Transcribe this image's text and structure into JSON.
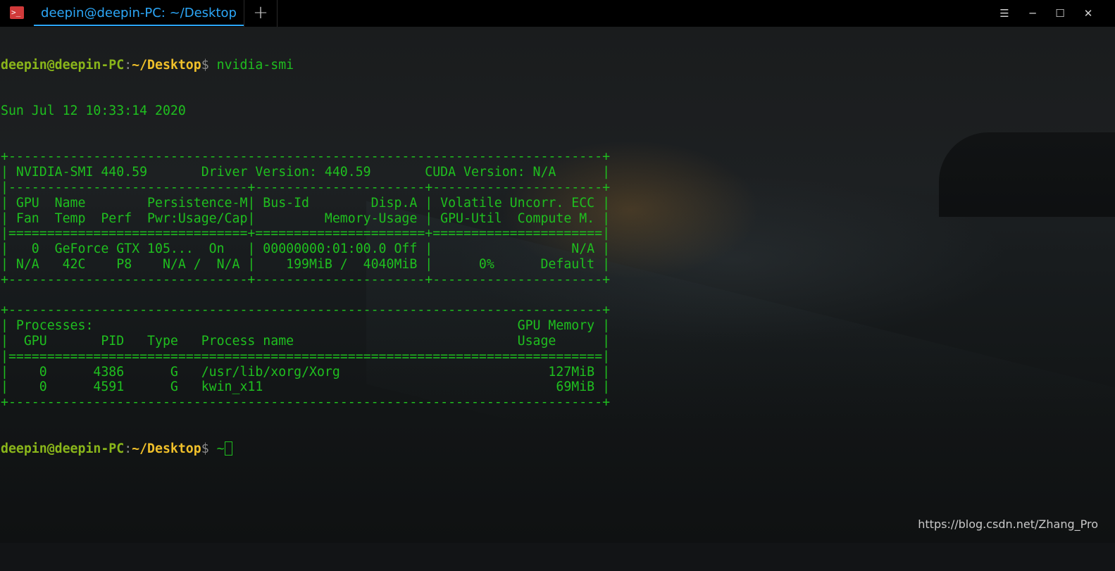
{
  "window": {
    "tab_title": "deepin@deepin-PC: ~/Desktop",
    "add_tab_glyph": "+",
    "controls": {
      "menu": "☰",
      "minimize": "─",
      "maximize": "☐",
      "close": "✕"
    },
    "icons": [
      "terminal-app-icon",
      "menu-icon",
      "minimize-icon",
      "maximize-icon",
      "close-icon"
    ]
  },
  "prompt": {
    "user_host": "deepin@deepin-PC",
    "sep": ":",
    "path": "~/Desktop",
    "dollar": "$ "
  },
  "command": "nvidia-smi",
  "date": "Sun Jul 12 10:33:14 2020",
  "smi_table": [
    "+-----------------------------------------------------------------------------+",
    "| NVIDIA-SMI 440.59       Driver Version: 440.59       CUDA Version: N/A      |",
    "|-------------------------------+----------------------+----------------------+",
    "| GPU  Name        Persistence-M| Bus-Id        Disp.A | Volatile Uncorr. ECC |",
    "| Fan  Temp  Perf  Pwr:Usage/Cap|         Memory-Usage | GPU-Util  Compute M. |",
    "|===============================+======================+======================|",
    "|   0  GeForce GTX 105...  On   | 00000000:01:00.0 Off |                  N/A |",
    "| N/A   42C    P8    N/A /  N/A |    199MiB /  4040MiB |      0%      Default |",
    "+-------------------------------+----------------------+----------------------+",
    "",
    "+-----------------------------------------------------------------------------+",
    "| Processes:                                                       GPU Memory |",
    "|  GPU       PID   Type   Process name                             Usage      |",
    "|=============================================================================|",
    "|    0      4386      G   /usr/lib/xorg/Xorg                           127MiB |",
    "|    0      4591      G   kwin_x11                                      69MiB |",
    "+-----------------------------------------------------------------------------+"
  ],
  "final_prompt_input": "~",
  "watermark": "https://blog.csdn.net/Zhang_Pro",
  "colors": {
    "terminal_green": "#1fbf1f",
    "prompt_user": "#8ab61a",
    "prompt_path": "#f0c02a",
    "tab_accent": "#2ca7f8",
    "titlebar": "#000000"
  }
}
